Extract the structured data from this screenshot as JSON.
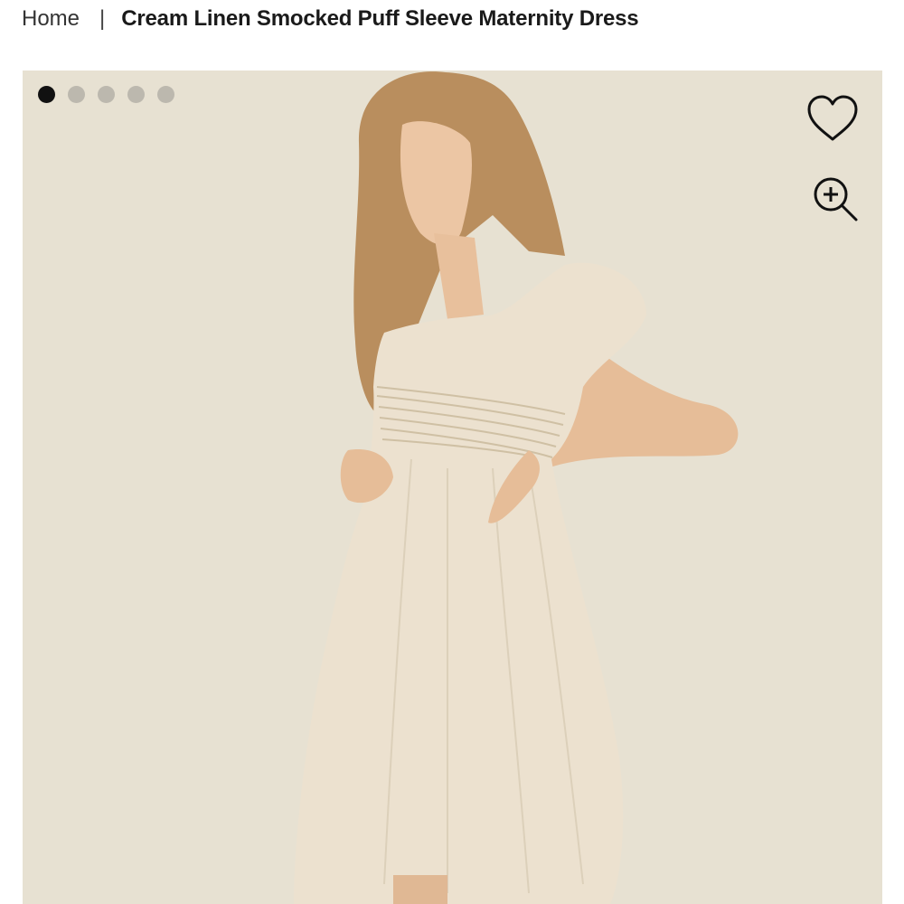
{
  "breadcrumb": {
    "home": "Home",
    "separator": "|",
    "current": "Cream Linen Smocked Puff Sleeve Maternity Dress"
  },
  "gallery": {
    "image_count": 5,
    "active_index": 0,
    "background_color": "#e7e1d2",
    "icons": [
      "heart-icon",
      "zoom-in-icon"
    ]
  }
}
